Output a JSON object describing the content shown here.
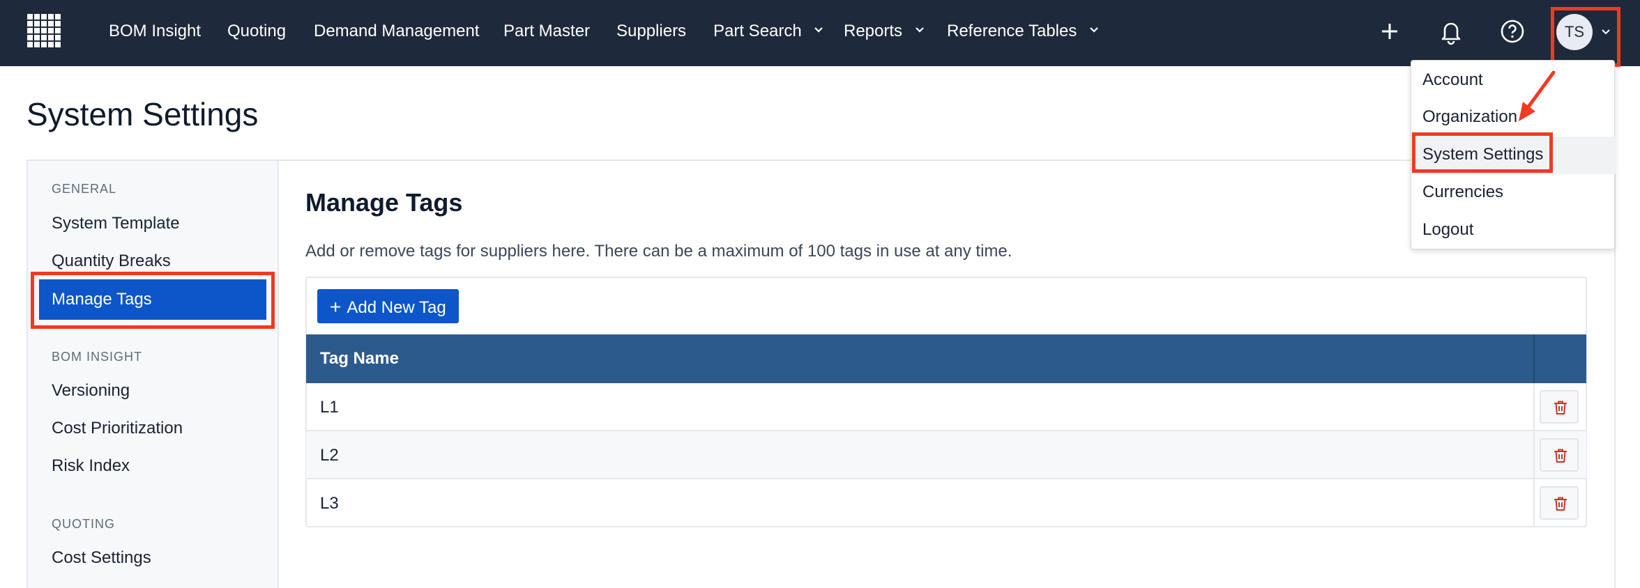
{
  "topnav": {
    "items": [
      "BOM Insight",
      "Quoting",
      "Demand Management",
      "Part Master",
      "Suppliers",
      "Part Search",
      "Reports",
      "Reference Tables"
    ],
    "icons": [
      "plus-icon",
      "bell-icon",
      "help-icon"
    ],
    "avatar_initials": "TS"
  },
  "page": {
    "title": "System Settings"
  },
  "sidebar": {
    "sections": [
      {
        "label": "GENERAL",
        "items": [
          "System Template",
          "Quantity Breaks",
          "Manage Tags"
        ]
      },
      {
        "label": "BOM INSIGHT",
        "items": [
          "Versioning",
          "Cost Prioritization",
          "Risk Index"
        ]
      },
      {
        "label": "QUOTING",
        "items": [
          "Cost Settings"
        ]
      }
    ],
    "active_item": "Manage Tags"
  },
  "content": {
    "title": "Manage Tags",
    "description": "Add or remove tags for suppliers here. There can be a maximum of 100 tags in use at any time.",
    "add_button": "Add New Tag",
    "table": {
      "header": "Tag Name",
      "rows": [
        "L1",
        "L2",
        "L3"
      ]
    }
  },
  "user_menu": {
    "items": [
      "Account",
      "Organization",
      "System Settings",
      "Currencies",
      "Logout"
    ],
    "highlighted": "System Settings"
  },
  "colors": {
    "nav_bg": "#1e2a3b",
    "primary": "#0d56c9",
    "table_header": "#2d5a8c",
    "highlight_outline": "#ef3a22",
    "delete_icon": "#c0392b"
  }
}
